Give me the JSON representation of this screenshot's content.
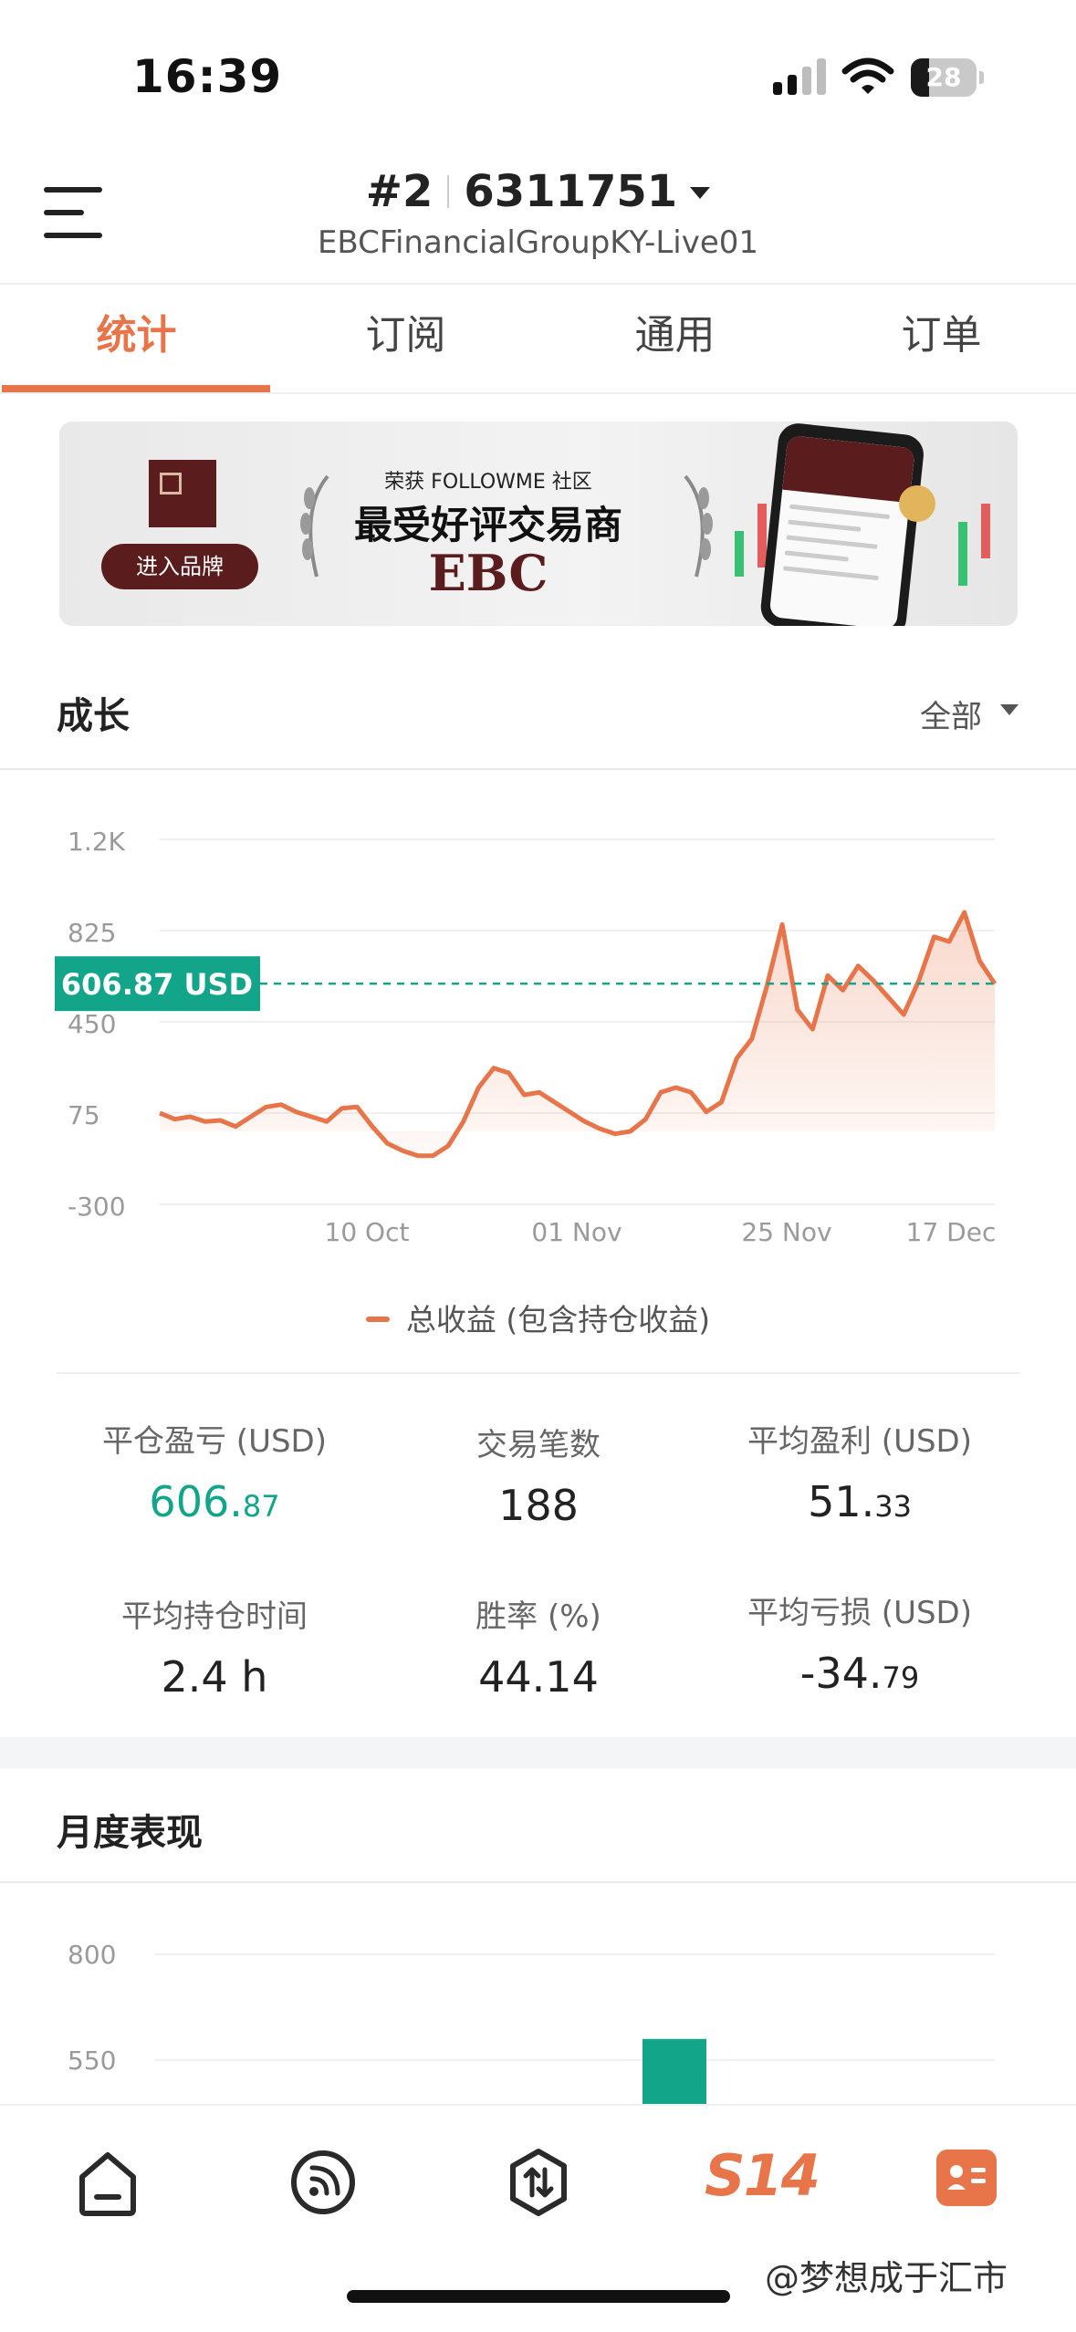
{
  "status": {
    "time": "16:39",
    "battery": "28",
    "battery_level": 0.28
  },
  "header": {
    "account_index": "#2",
    "account_number": "6311751",
    "server": "EBCFinancialGroupKY-Live01"
  },
  "tabs": [
    {
      "label": "统计",
      "active": true
    },
    {
      "label": "订阅",
      "active": false
    },
    {
      "label": "通用",
      "active": false
    },
    {
      "label": "订单",
      "active": false
    }
  ],
  "banner": {
    "award_top": "荣获 FOLLOWME 社区",
    "award_title": "最受好评交易商",
    "brand": "EBC",
    "button": "进入品牌",
    "brand_color": "#5a1c1c"
  },
  "growth": {
    "title": "成长",
    "filter": "全部",
    "current_badge": "606.87 USD",
    "legend": "总收益 (包含持仓收益)"
  },
  "chart_data": {
    "type": "area",
    "ylim": [
      -300,
      1200
    ],
    "yticks": [
      "1.2K",
      "825",
      "450",
      "75",
      "-300"
    ],
    "xticks": [
      "10 Oct",
      "01 Nov",
      "25 Nov",
      "17 Dec"
    ],
    "reference_value": 606.87,
    "series": [
      {
        "name": "总收益 (包含持仓收益)",
        "color": "#e8744a",
        "y": [
          75,
          50,
          60,
          40,
          45,
          20,
          60,
          100,
          110,
          80,
          60,
          40,
          95,
          100,
          20,
          -50,
          -80,
          -100,
          -100,
          -60,
          40,
          180,
          260,
          240,
          150,
          160,
          120,
          80,
          40,
          10,
          -10,
          0,
          50,
          160,
          180,
          160,
          80,
          120,
          300,
          380,
          600,
          850,
          500,
          420,
          640,
          580,
          680,
          620,
          550,
          480,
          620,
          800,
          780,
          900,
          700,
          606.87
        ]
      }
    ]
  },
  "stats": [
    {
      "label": "平仓盈亏 (USD)",
      "int": "606.",
      "frac": "87",
      "green": true
    },
    {
      "label": "交易笔数",
      "int": "188",
      "frac": "",
      "green": false
    },
    {
      "label": "平均盈利 (USD)",
      "int": "51.",
      "frac": "33",
      "green": false
    },
    {
      "label": "平均持仓时间",
      "int": "2.4 h",
      "frac": "",
      "green": false
    },
    {
      "label": "胜率 (%)",
      "int": "44.14",
      "frac": "",
      "green": false
    },
    {
      "label": "平均亏损 (USD)",
      "int": "-34.",
      "frac": "79",
      "green": false
    }
  ],
  "monthly": {
    "title": "月度表现",
    "yticks": [
      "800",
      "550"
    ],
    "visible_bar_top_value": 600
  },
  "nav": {
    "s14": "S14"
  },
  "watermark": "@梦想成于汇市",
  "colors": {
    "accent": "#e8744a",
    "positive": "#12a58a",
    "badge": "#12a58a"
  }
}
